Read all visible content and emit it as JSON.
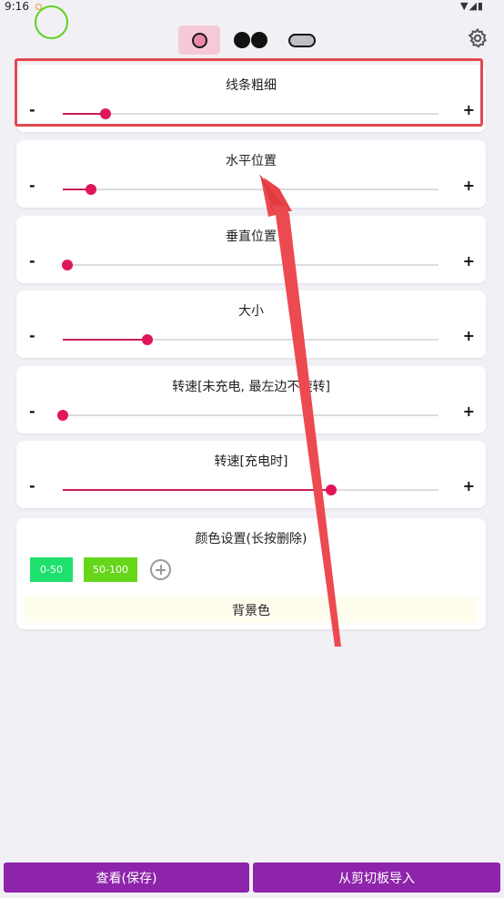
{
  "status_bar": {
    "time": "9:16",
    "icons": "▼◢▮"
  },
  "tabs": [
    {
      "name": "circle",
      "selected": true
    },
    {
      "name": "glasses",
      "selected": false
    },
    {
      "name": "pill",
      "selected": false
    }
  ],
  "sliders": [
    {
      "label": "线条粗细",
      "minus": "-",
      "plus": "+",
      "value": 0.113
    },
    {
      "label": "水平位置",
      "minus": "-",
      "plus": "+",
      "value": 0.075
    },
    {
      "label": "垂直位置",
      "minus": "-",
      "plus": "+",
      "value": 0.012
    },
    {
      "label": "大小",
      "minus": "-",
      "plus": "+",
      "value": 0.225
    },
    {
      "label": "转速[未充电, 最左边不旋转]",
      "minus": "-",
      "plus": "+",
      "value": 0.0
    },
    {
      "label": "转速[充电时]",
      "minus": "-",
      "plus": "+",
      "value": 0.714
    }
  ],
  "colors": {
    "title": "颜色设置(长按删除)",
    "chips": [
      {
        "label": "0-50",
        "color": "#1ee06d"
      },
      {
        "label": "50-100",
        "color": "#66d61b"
      }
    ],
    "background_label": "背景色"
  },
  "buttons": {
    "view_save": "查看(保存)",
    "import_clipboard": "从剪切板导入"
  },
  "accent_colors": {
    "slider": "#e0165c",
    "button": "#8e24aa",
    "ring": "#5fd21f",
    "highlight": "#e34850"
  }
}
